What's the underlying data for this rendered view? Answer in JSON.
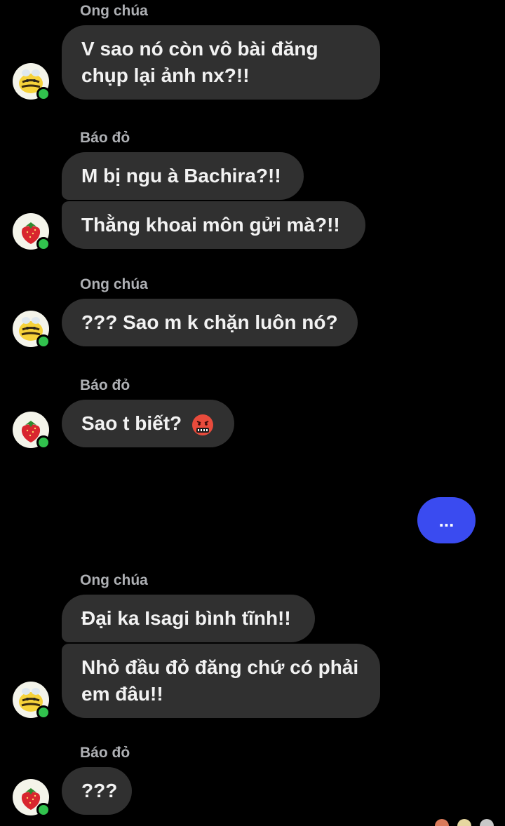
{
  "messages": [
    {
      "sender": "Ong chúa",
      "avatar": "bee-avatar",
      "bubbles": [
        "V sao nó còn vô bài đăng chụp lại ảnh nx?!!"
      ]
    },
    {
      "sender": "Báo đỏ",
      "avatar": "strawberry-avatar",
      "bubbles": [
        "M bị ngu à Bachira?!!",
        "Thằng khoai môn gửi mà?!!"
      ]
    },
    {
      "sender": "Ong chúa",
      "avatar": "bee-avatar",
      "bubbles": [
        "??? Sao m k chặn luôn nó?"
      ]
    },
    {
      "sender": "Báo đỏ",
      "avatar": "strawberry-avatar",
      "bubbles": [
        "Sao t biết?"
      ],
      "emoji": "angry-cursing-face-emoji"
    },
    {
      "sender": "Ong chúa",
      "avatar": "bee-avatar",
      "bubbles": [
        "Đại ka Isagi bình tĩnh!!",
        "Nhỏ đầu đỏ đăng chứ có phải em đâu!!"
      ]
    },
    {
      "sender": "Báo đỏ",
      "avatar": "strawberry-avatar",
      "bubbles": [
        "???"
      ]
    }
  ],
  "typing_indicator": {
    "label": "..."
  },
  "colors": {
    "background": "#000000",
    "incoming_bubble": "#303030",
    "outgoing_bubble": "#3a4bf0",
    "online": "#31c24d"
  }
}
